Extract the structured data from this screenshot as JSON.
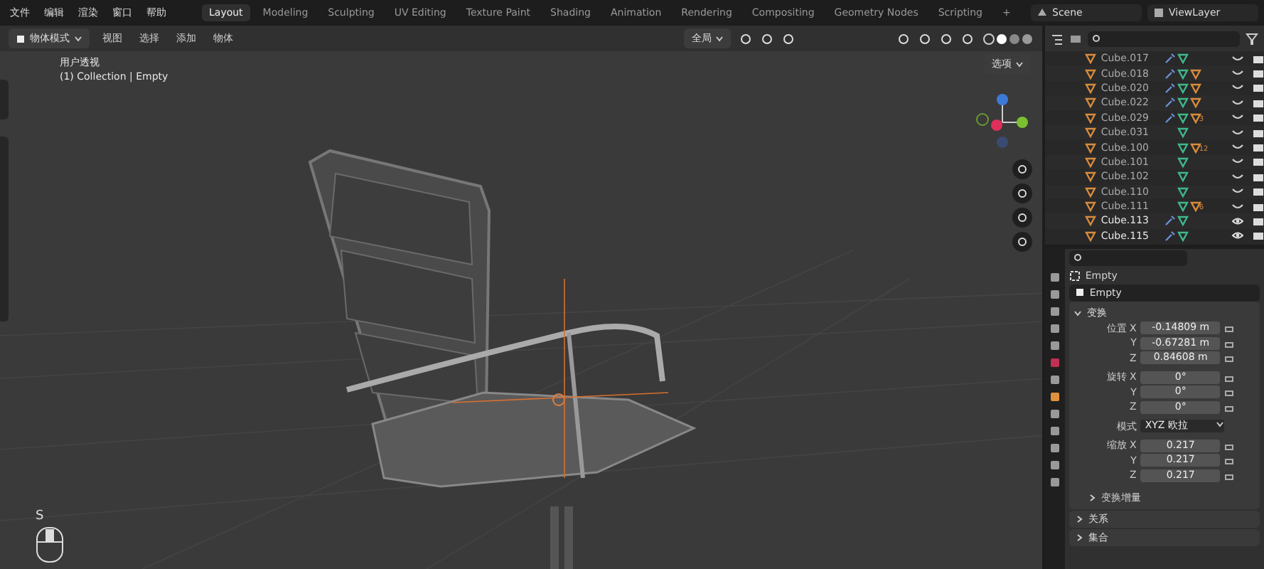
{
  "menu": [
    "文件",
    "编辑",
    "渲染",
    "窗口",
    "帮助"
  ],
  "workspaces": [
    {
      "label": "Layout",
      "selected": true
    },
    {
      "label": "Modeling",
      "selected": false
    },
    {
      "label": "Sculpting",
      "selected": false
    },
    {
      "label": "UV Editing",
      "selected": false
    },
    {
      "label": "Texture Paint",
      "selected": false
    },
    {
      "label": "Shading",
      "selected": false
    },
    {
      "label": "Animation",
      "selected": false
    },
    {
      "label": "Rendering",
      "selected": false
    },
    {
      "label": "Compositing",
      "selected": false
    },
    {
      "label": "Geometry Nodes",
      "selected": false
    },
    {
      "label": "Scripting",
      "selected": false
    },
    {
      "label": "+",
      "selected": false
    }
  ],
  "scene": {
    "scene": "Scene",
    "view_layer": "ViewLayer"
  },
  "viewport": {
    "mode": "物体模式",
    "menus": [
      "视图",
      "选择",
      "添加",
      "物体"
    ],
    "orientation": "全局",
    "options": "选项",
    "view_name": "用户透视",
    "context": "(1) Collection | Empty",
    "key": "S"
  },
  "outliner": {
    "rows": [
      {
        "name": "Cube.017",
        "modifier": true,
        "material": false,
        "visible": false
      },
      {
        "name": "Cube.018",
        "modifier": true,
        "material": true,
        "visible": false
      },
      {
        "name": "Cube.020",
        "modifier": true,
        "material": true,
        "visible": false
      },
      {
        "name": "Cube.022",
        "modifier": true,
        "material": true,
        "visible": false
      },
      {
        "name": "Cube.029",
        "modifier": true,
        "material": true,
        "count": "3",
        "visible": false
      },
      {
        "name": "Cube.031",
        "modifier": false,
        "material": false,
        "visible": false
      },
      {
        "name": "Cube.100",
        "modifier": false,
        "material": true,
        "count": "12",
        "visible": false
      },
      {
        "name": "Cube.101",
        "modifier": false,
        "material": false,
        "visible": false
      },
      {
        "name": "Cube.102",
        "modifier": false,
        "material": false,
        "visible": false
      },
      {
        "name": "Cube.110",
        "modifier": false,
        "material": false,
        "visible": false
      },
      {
        "name": "Cube.111",
        "modifier": false,
        "material": true,
        "count": "6",
        "visible": false
      },
      {
        "name": "Cube.113",
        "modifier": true,
        "material": false,
        "visible": true
      },
      {
        "name": "Cube.115",
        "modifier": true,
        "material": false,
        "visible": true
      }
    ]
  },
  "properties": {
    "object_name": "Empty",
    "data_name": "Empty",
    "panel": {
      "title": "变换",
      "expanded": true
    },
    "groups": [
      {
        "label": "位置",
        "values": [
          {
            "axis": "X",
            "value": "-0.14809 m"
          },
          {
            "axis": "Y",
            "value": "-0.67281 m"
          },
          {
            "axis": "Z",
            "value": "0.84608 m"
          }
        ]
      },
      {
        "label": "旋转",
        "values": [
          {
            "axis": "X",
            "value": "0°"
          },
          {
            "axis": "Y",
            "value": "0°"
          },
          {
            "axis": "Z",
            "value": "0°"
          }
        ]
      },
      {
        "label": "模式",
        "dropdown": "XYZ 欧拉"
      },
      {
        "label": "缩放",
        "values": [
          {
            "axis": "X",
            "value": "0.217"
          },
          {
            "axis": "Y",
            "value": "0.217"
          },
          {
            "axis": "Z",
            "value": "0.217"
          }
        ]
      }
    ],
    "subpanel": "变换增量",
    "panels": [
      "关系",
      "集合"
    ]
  }
}
